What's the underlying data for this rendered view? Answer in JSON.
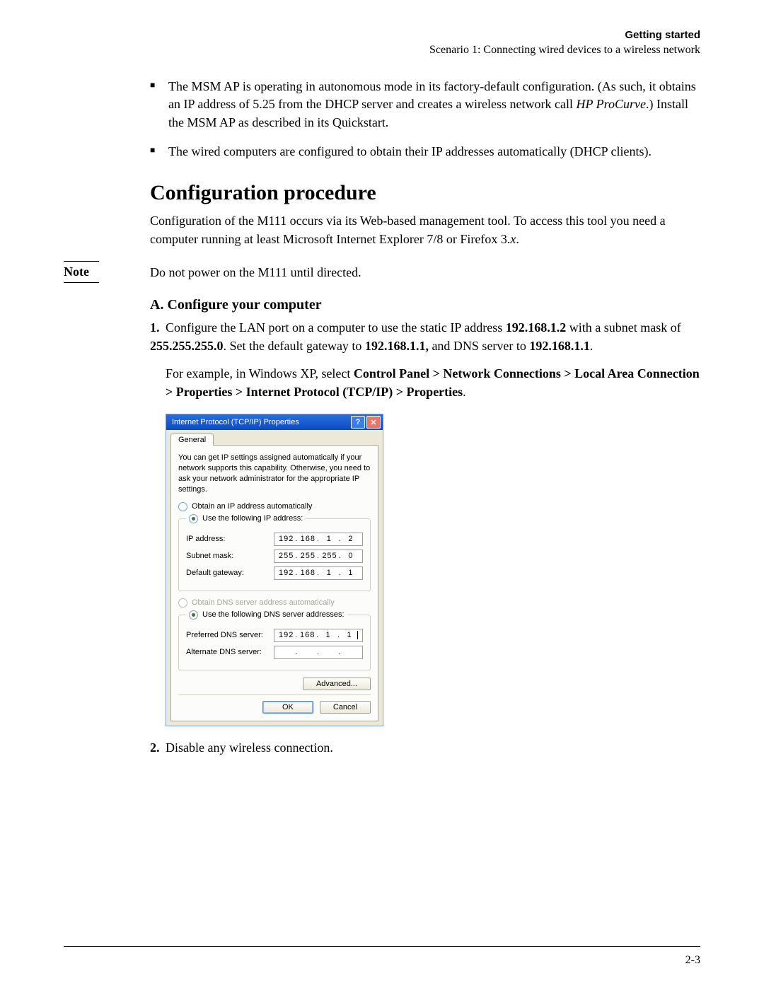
{
  "header": {
    "title": "Getting started",
    "subtitle": "Scenario 1: Connecting wired devices to a wireless network"
  },
  "bullets": [
    {
      "pre": "The MSM AP is operating in autonomous mode in its factory-default configuration. (As such, it obtains an IP address of 5.25 from the DHCP server and creates a wireless network call ",
      "em": "HP ProCurve",
      "post": ".) Install the MSM AP as described in its Quickstart."
    },
    {
      "pre": "The wired computers are configured to obtain their IP addresses automatically (DHCP clients).",
      "em": "",
      "post": ""
    }
  ],
  "section_title": "Configuration procedure",
  "intro": {
    "pre": "Configuration of the M111 occurs via its Web-based management tool. To access this tool you need a computer running at least Microsoft Internet Explorer 7/8 or Firefox 3.",
    "em": "x",
    "post": "."
  },
  "note": {
    "label": "Note",
    "text": "Do not power on the M111 until directed."
  },
  "sub_a": "A. Configure your computer",
  "step1": {
    "num": "1.",
    "t1": "Configure the LAN port on a computer to use the static IP address ",
    "b1": "192.168.1.2",
    "t2": " with a subnet mask of ",
    "b2": "255.255.255.0",
    "t3": ". Set the default gateway to ",
    "b3": "192.168.1.1,",
    "t4": " and DNS server to ",
    "b4": "192.168.1.1",
    "t5": "."
  },
  "step1_ex": {
    "t1": "For example, in Windows XP, select ",
    "b1": "Control Panel > Network Connections > Local Area Connection > Properties > Internet Protocol (TCP/IP) > Properties",
    "t2": "."
  },
  "step2": {
    "num": "2.",
    "text": "Disable any wireless connection."
  },
  "dialog": {
    "title": "Internet Protocol (TCP/IP) Properties",
    "tab": "General",
    "desc": "You can get IP settings assigned automatically if your network supports this capability. Otherwise, you need to ask your network administrator for the appropriate IP settings.",
    "r_auto_ip": "Obtain an IP address automatically",
    "r_use_ip": "Use the following IP address:",
    "l_ip": "IP address:",
    "l_mask": "Subnet mask:",
    "l_gw": "Default gateway:",
    "r_auto_dns": "Obtain DNS server address automatically",
    "r_use_dns": "Use the following DNS server addresses:",
    "l_pdns": "Preferred DNS server:",
    "l_adns": "Alternate DNS server:",
    "btn_adv": "Advanced...",
    "btn_ok": "OK",
    "btn_cancel": "Cancel",
    "ip": [
      "192",
      "168",
      "1",
      "2"
    ],
    "mask": [
      "255",
      "255",
      "255",
      "0"
    ],
    "gw": [
      "192",
      "168",
      "1",
      "1"
    ],
    "pdns": [
      "192",
      "168",
      "1",
      "1"
    ],
    "adns": [
      "",
      "",
      "",
      ""
    ]
  },
  "page_no": "2-3"
}
